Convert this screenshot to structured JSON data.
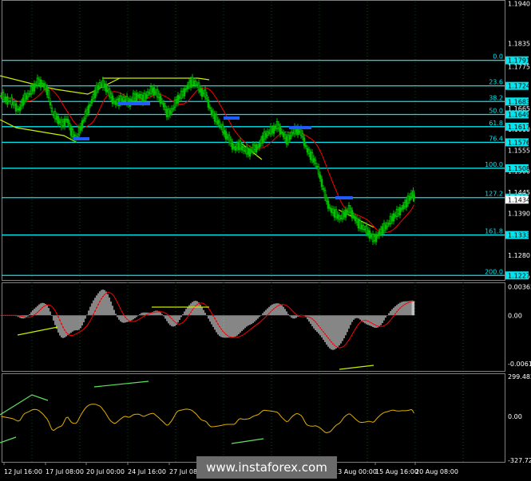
{
  "watermark": {
    "text": "www.instaforex.com"
  },
  "colors": {
    "background": "#000000",
    "grid": "#2a4a2a",
    "candle": "#00c000",
    "fib_line": "#00e5ee",
    "channel": "#c8f000",
    "ma": "#ff0000",
    "oscillator": "#e0b000",
    "histogram": "#c0c0c0",
    "marker": "#1e5cff"
  },
  "time_axis": {
    "labels": [
      "12 Jul 16:00",
      "17 Jul 08:00",
      "20 Jul 00:00",
      "24 Jul 16:00",
      "27 Jul 08:00",
      "13 Aug 00:00",
      "15 Aug 16:00",
      "20 Aug 08:00"
    ]
  },
  "chart_data": [
    {
      "type": "line",
      "panel": "price",
      "y_ticks": [
        "1.1940",
        "1.1835",
        "1.1775",
        "1.1665",
        "1.1610",
        "1.1555",
        "1.1500",
        "1.1445",
        "1.1390",
        "1.1280",
        "1.1225"
      ],
      "ylim": [
        1.1215,
        1.1945
      ],
      "fib_levels": [
        {
          "ratio": "0.0",
          "value": 1.1791,
          "tag": "1.1791"
        },
        {
          "ratio": "23.6",
          "value": 1.1724,
          "tag": "1.1724"
        },
        {
          "ratio": "38.2",
          "value": 1.1683,
          "tag": "1.1683"
        },
        {
          "ratio": "50.0",
          "value": 1.1649,
          "tag": "1.1649"
        },
        {
          "ratio": "61.8",
          "value": 1.1617,
          "tag": "1.1617"
        },
        {
          "ratio": "76.4",
          "value": 1.1576,
          "tag": "1.1576"
        },
        {
          "ratio": "100.0",
          "value": 1.1508,
          "tag": "1.1508"
        },
        {
          "ratio": "127.2",
          "value": 1.1431,
          "tag": "1.1431"
        },
        {
          "ratio": "161.8",
          "value": 1.1333,
          "tag": "1.1333"
        },
        {
          "ratio": "200.0",
          "value": 1.1227,
          "tag": "1.1227"
        }
      ],
      "current_price": "1.1434",
      "series": [
        {
          "x": [
            0,
            8,
            16,
            24,
            30,
            36,
            42,
            48,
            54,
            60,
            66,
            72,
            78,
            84,
            90,
            96,
            102,
            108,
            114,
            120,
            126,
            132,
            138,
            144,
            150,
            156,
            162,
            168,
            174,
            180,
            186,
            192,
            198,
            204,
            210,
            216,
            222,
            228,
            234,
            240,
            246,
            252,
            258,
            264,
            270,
            276,
            282,
            288,
            294,
            300,
            306,
            312,
            318,
            324,
            330,
            336,
            342,
            348,
            354,
            360,
            366,
            372,
            378,
            384,
            390,
            396,
            402,
            408,
            414,
            420,
            426,
            432,
            438,
            444,
            450,
            456,
            462,
            468,
            474,
            480,
            486,
            492,
            498,
            504,
            510,
            516,
            519
          ],
          "y": [
            1.17,
            1.169,
            1.168,
            1.166,
            1.169,
            1.17,
            1.172,
            1.1735,
            1.173,
            1.171,
            1.165,
            1.164,
            1.162,
            1.164,
            1.16,
            1.1585,
            1.162,
            1.165,
            1.168,
            1.171,
            1.173,
            1.1725,
            1.17,
            1.168,
            1.1685,
            1.169,
            1.168,
            1.1695,
            1.17,
            1.169,
            1.1705,
            1.1715,
            1.17,
            1.168,
            1.165,
            1.166,
            1.169,
            1.17,
            1.172,
            1.1735,
            1.173,
            1.171,
            1.17,
            1.166,
            1.164,
            1.162,
            1.16,
            1.158,
            1.156,
            1.157,
            1.1555,
            1.155,
            1.156,
            1.1565,
            1.159,
            1.16,
            1.161,
            1.162,
            1.16,
            1.158,
            1.16,
            1.161,
            1.16,
            1.156,
            1.154,
            1.152,
            1.148,
            1.143,
            1.14,
            1.139,
            1.1375,
            1.139,
            1.14,
            1.138,
            1.136,
            1.135,
            1.134,
            1.132,
            1.1335,
            1.135,
            1.136,
            1.138,
            1.139,
            1.1405,
            1.142,
            1.144,
            1.1434
          ]
        }
      ]
    },
    {
      "type": "bar",
      "panel": "macd",
      "y_ticks": [
        "0.00362",
        "0.00",
        "-0.00619"
      ],
      "ylim": [
        -0.0071,
        0.004
      ]
    },
    {
      "type": "line",
      "panel": "oscillator",
      "y_ticks": [
        "299.482",
        "0.00",
        "-327.725"
      ],
      "ylim": [
        -340,
        310
      ]
    }
  ]
}
